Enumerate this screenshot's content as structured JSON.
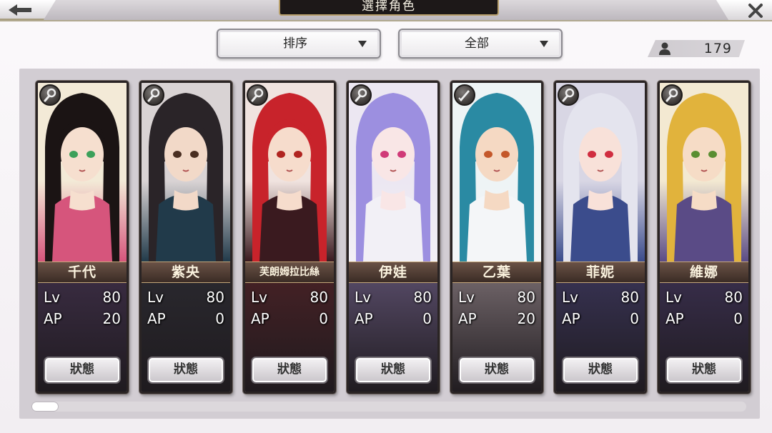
{
  "header": {
    "title": "選擇角色"
  },
  "filters": {
    "sort_label": "排序",
    "filter_label": "全部"
  },
  "roster": {
    "count": "179"
  },
  "labels": {
    "lv": "Lv",
    "ap": "AP",
    "status_button": "狀態"
  },
  "characters": [
    {
      "name": "千代",
      "lv": "80",
      "ap": "20",
      "class_icon": "staff-icon",
      "palette": {
        "bg": "#f3ead7",
        "hair": "#1b1414",
        "skin": "#f6dfcf",
        "eye": "#3ca05a",
        "outfit": "#d6557c",
        "lower": "#3d2e46"
      }
    },
    {
      "name": "紫央",
      "lv": "80",
      "ap": "0",
      "class_icon": "staff-icon",
      "palette": {
        "bg": "#d9d3d4",
        "hair": "#2a2428",
        "skin": "#f2d9c8",
        "eye": "#4a2f22",
        "outfit": "#213a4a",
        "lower": "#2b2a30"
      }
    },
    {
      "name": "芙朗姆拉比絲",
      "lv": "80",
      "ap": "0",
      "class_icon": "staff-icon",
      "palette": {
        "bg": "#f0e3df",
        "hair": "#c8232b",
        "skin": "#f6dccc",
        "eye": "#b02420",
        "outfit": "#3a1a1f",
        "lower": "#4a2226"
      }
    },
    {
      "name": "伊娃",
      "lv": "80",
      "ap": "0",
      "class_icon": "staff-icon",
      "palette": {
        "bg": "#ece7f2",
        "hair": "#9c8fe0",
        "skin": "#f9e6e6",
        "eye": "#d03a78",
        "outfit": "#f2f0f6",
        "lower": "#5c4f6e"
      }
    },
    {
      "name": "乙葉",
      "lv": "80",
      "ap": "20",
      "class_icon": "sword-icon",
      "palette": {
        "bg": "#eef4f5",
        "hair": "#2a8aa3",
        "skin": "#f5d9c3",
        "eye": "#c4582a",
        "outfit": "#f4f6f8",
        "lower": "#7a6e72"
      }
    },
    {
      "name": "菲妮",
      "lv": "80",
      "ap": "0",
      "class_icon": "staff-icon",
      "palette": {
        "bg": "#d8d6e4",
        "hair": "#e4e4ee",
        "skin": "#f8e1d9",
        "eye": "#d02d40",
        "outfit": "#3b4c8c",
        "lower": "#3a3558"
      }
    },
    {
      "name": "維娜",
      "lv": "80",
      "ap": "0",
      "class_icon": "staff-icon",
      "palette": {
        "bg": "#f3e9d2",
        "hair": "#e1b33c",
        "skin": "#f6dcc6",
        "eye": "#5a8e32",
        "outfit": "#5a4b86",
        "lower": "#3b3050"
      }
    }
  ]
}
